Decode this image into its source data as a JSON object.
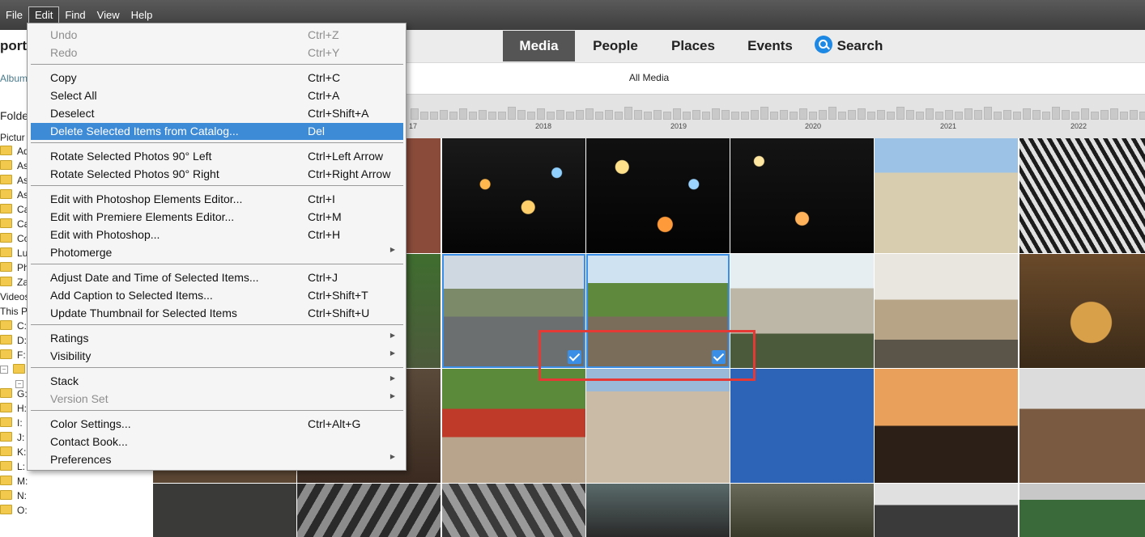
{
  "menubar": [
    "File",
    "Edit",
    "Find",
    "View",
    "Help"
  ],
  "header": {
    "import_label": "port",
    "tabs": [
      "Media",
      "People",
      "Places",
      "Events"
    ],
    "search_label": "Search"
  },
  "subheader": {
    "all_media": "All Media"
  },
  "left_panel": {
    "albums_label": "Albums",
    "folders_label": "Folder",
    "pictures_label": "Pictur",
    "folders": [
      "Ad",
      "As",
      "As",
      "As",
      "Ca",
      "Ca",
      "Co",
      "Lu",
      "Ph",
      "Za"
    ],
    "videos_label": "Videos",
    "this_pc_label": "This P",
    "drives": [
      "C:",
      "D:",
      "F:",
      "",
      "",
      "G:",
      "H:",
      "I:",
      "J:",
      "K:",
      "L:",
      "M:",
      "N:",
      "O:"
    ]
  },
  "timeline": {
    "years": [
      "17",
      "2018",
      "2019",
      "2020",
      "2021",
      "2022"
    ]
  },
  "edit_menu": {
    "items": [
      {
        "label": "Undo",
        "shortcut": "Ctrl+Z"
      },
      {
        "label": "Redo",
        "shortcut": "Ctrl+Y"
      },
      {
        "label": "Copy",
        "shortcut": "Ctrl+C"
      },
      {
        "label": "Select All",
        "shortcut": "Ctrl+A"
      },
      {
        "label": "Deselect",
        "shortcut": "Ctrl+Shift+A"
      },
      {
        "label": "Delete Selected Items from Catalog...",
        "shortcut": "Del"
      },
      {
        "label": "Rotate Selected Photos 90° Left",
        "shortcut": "Ctrl+Left Arrow"
      },
      {
        "label": "Rotate Selected Photos 90° Right",
        "shortcut": "Ctrl+Right Arrow"
      },
      {
        "label": "Edit with Photoshop Elements Editor...",
        "shortcut": "Ctrl+I"
      },
      {
        "label": "Edit with Premiere Elements Editor...",
        "shortcut": "Ctrl+M"
      },
      {
        "label": "Edit with Photoshop...",
        "shortcut": "Ctrl+H"
      },
      {
        "label": "Photomerge",
        "shortcut": ""
      },
      {
        "label": "Adjust Date and Time of Selected Items...",
        "shortcut": "Ctrl+J"
      },
      {
        "label": "Add Caption to Selected Items...",
        "shortcut": "Ctrl+Shift+T"
      },
      {
        "label": "Update Thumbnail for Selected Items",
        "shortcut": "Ctrl+Shift+U"
      },
      {
        "label": "Ratings",
        "shortcut": ""
      },
      {
        "label": "Visibility",
        "shortcut": ""
      },
      {
        "label": "Stack",
        "shortcut": ""
      },
      {
        "label": "Version Set",
        "shortcut": ""
      },
      {
        "label": "Color Settings...",
        "shortcut": "Ctrl+Alt+G"
      },
      {
        "label": "Contact Book...",
        "shortcut": ""
      },
      {
        "label": "Preferences",
        "shortcut": ""
      }
    ],
    "disabled": [
      "Undo",
      "Redo",
      "Version Set"
    ],
    "highlighted": "Delete Selected Items from Catalog...",
    "submenus": [
      "Photomerge",
      "Ratings",
      "Visibility",
      "Stack",
      "Version Set",
      "Preferences"
    ]
  },
  "colors": {
    "menu_highlight": "#3d8ad7",
    "selection_border": "#3a8ee6",
    "annotation_box": "#e53935",
    "active_tab": "#555555"
  }
}
